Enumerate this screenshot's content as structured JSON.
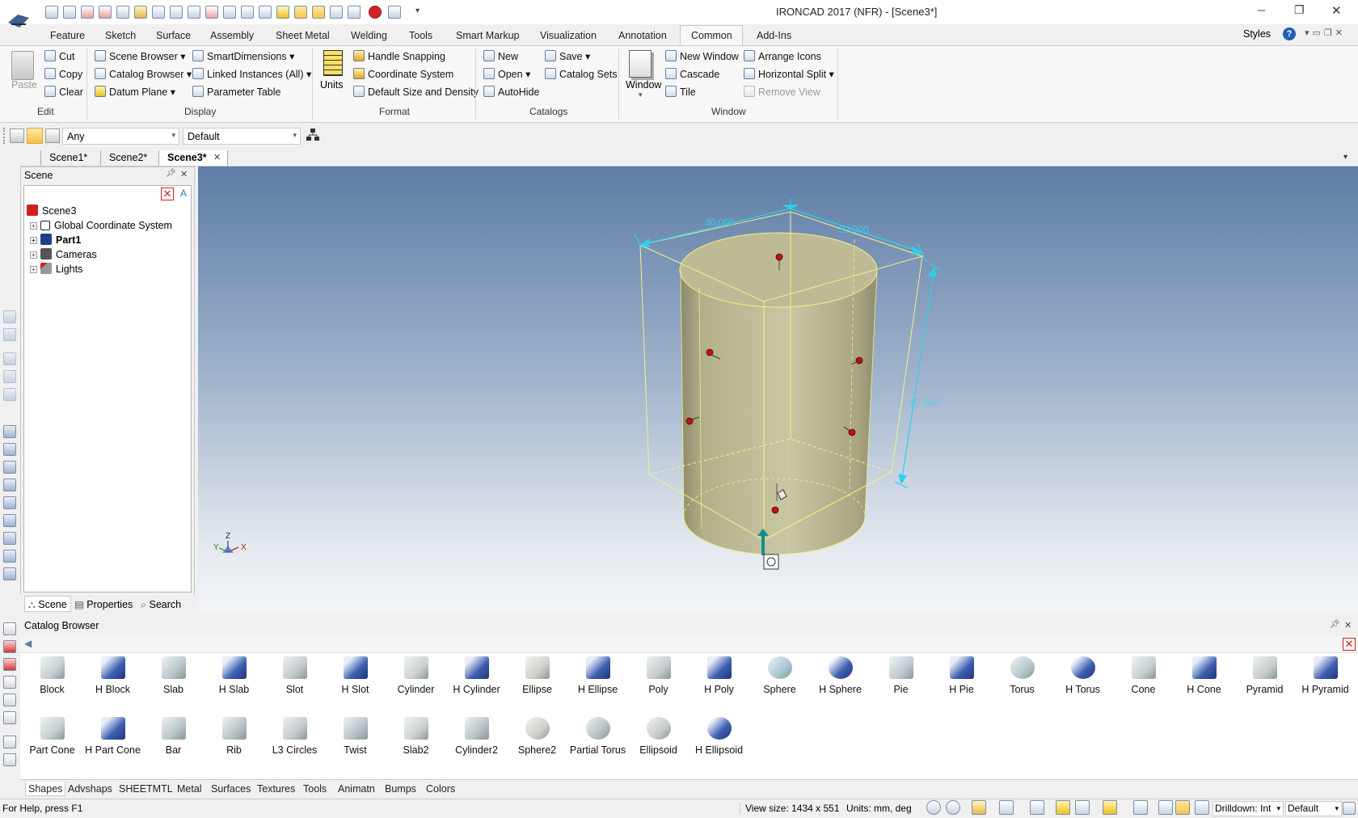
{
  "title": "IRONCAD 2017 (NFR) - [Scene3*]",
  "window_controls": {
    "minimize": "─",
    "maximize": "❐",
    "close": "✕"
  },
  "ribbon_tabs": [
    "Feature",
    "Sketch",
    "Surface",
    "Assembly",
    "Sheet Metal",
    "Welding",
    "Tools",
    "Smart Markup",
    "Visualization",
    "Annotation",
    "Common",
    "Add-Ins"
  ],
  "active_tab": "Common",
  "styles_label": "Styles",
  "edit": {
    "paste": "Paste",
    "cut": "Cut",
    "copy": "Copy",
    "clear": "Clear",
    "group": "Edit"
  },
  "display": {
    "scene_browser": "Scene Browser",
    "catalog_browser": "Catalog Browser",
    "datum_plane": "Datum Plane",
    "smart_dimensions": "SmartDimensions",
    "linked_instances": "Linked Instances (All)",
    "parameter_table": "Parameter Table",
    "group": "Display"
  },
  "format": {
    "units": "Units",
    "handle_snapping": "Handle Snapping",
    "coordinate_system": "Coordinate System",
    "default_size": "Default Size and Density",
    "group": "Format"
  },
  "catalogs": {
    "new": "New",
    "open": "Open",
    "autohide": "AutoHide",
    "save": "Save",
    "catalog_sets": "Catalog Sets",
    "group": "Catalogs"
  },
  "window": {
    "window": "Window",
    "new_window": "New Window",
    "cascade": "Cascade",
    "tile": "Tile",
    "arrange_icons": "Arrange Icons",
    "horizontal_split": "Horizontal Split",
    "remove_view": "Remove View",
    "group": "Window"
  },
  "toolbar": {
    "filter_value": "Any",
    "style_value": "Default"
  },
  "doc_tabs": [
    "Scene1*",
    "Scene2*",
    "Scene3*"
  ],
  "scene_panel": {
    "title": "Scene",
    "tree": [
      {
        "label": "Scene3"
      },
      {
        "label": "Global Coordinate System"
      },
      {
        "label": "Part1"
      },
      {
        "label": "Cameras"
      },
      {
        "label": "Lights"
      }
    ],
    "bottom_tabs": [
      "Scene",
      "Properties",
      "Search"
    ]
  },
  "viewport": {
    "dim_width": "30.000",
    "dim_depth": "30.000",
    "dim_height": "40.000",
    "axis": {
      "x": "X",
      "y": "Y",
      "z": "Z"
    },
    "colors": {
      "bg_top": "#5f7ea6",
      "bg_bottom": "#f2f4f7",
      "body": "#b8b592",
      "box": "#f5f08a",
      "dim": "#2fd0ee",
      "handle": "#c0101a"
    }
  },
  "catalog": {
    "title": "Catalog Browser",
    "row1": [
      "Block",
      "H Block",
      "Slab",
      "H Slab",
      "Slot",
      "H Slot",
      "Cylinder",
      "H Cylinder",
      "Ellipse",
      "H Ellipse",
      "Poly",
      "H Poly",
      "Sphere",
      "H Sphere",
      "Pie",
      "H Pie",
      "Torus",
      "H Torus",
      "Cone",
      "H Cone",
      "Pyramid",
      "H Pyramid"
    ],
    "row2": [
      "Part Cone",
      "H Part Cone",
      "Bar",
      "Rib",
      "L3 Circles",
      "Twist",
      "Slab2",
      "Cylinder2",
      "Sphere2",
      "Partial Torus",
      "Ellipsoid",
      "H Ellipsoid"
    ],
    "tabs": [
      "Shapes",
      "Advshaps",
      "SHEETMTL",
      "Metal",
      "Surfaces",
      "Textures",
      "Tools",
      "Animatn",
      "Bumps",
      "Colors"
    ]
  },
  "status": {
    "help": "For Help, press F1",
    "view_size": "View size: 1434 x  551",
    "units": "Units: mm, deg",
    "drilldown": "Drilldown: Int",
    "default": "Default"
  }
}
